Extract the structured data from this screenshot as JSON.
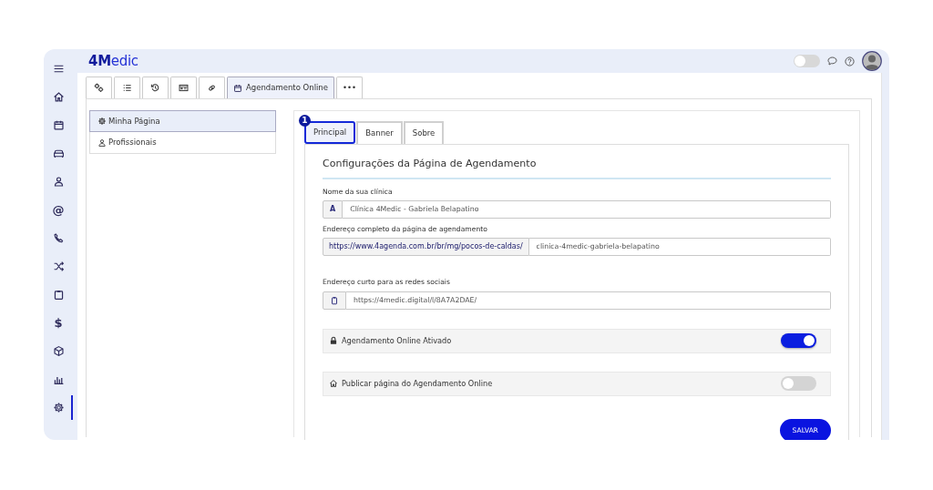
{
  "header": {
    "logo": "**4M**edic",
    "theme_toggle": {
      "on": false
    }
  },
  "sidebar": {
    "items": [
      {
        "kind": "home",
        "selected": false
      },
      {
        "kind": "calendar",
        "selected": false
      },
      {
        "kind": "sofa",
        "selected": false
      },
      {
        "kind": "person",
        "selected": false
      },
      {
        "kind": "glyph",
        "text": "@",
        "selected": false
      },
      {
        "kind": "phone",
        "selected": false
      },
      {
        "kind": "shuffle",
        "selected": false
      },
      {
        "kind": "clipboard",
        "selected": false
      },
      {
        "kind": "glyph",
        "text": "$",
        "selected": false
      },
      {
        "kind": "cube",
        "selected": false
      },
      {
        "kind": "chart",
        "selected": false
      },
      {
        "kind": "gear",
        "selected": true
      }
    ]
  },
  "tabs": [
    {
      "kind": "gears",
      "selected": false
    },
    {
      "kind": "list",
      "selected": false
    },
    {
      "kind": "history",
      "selected": false
    },
    {
      "kind": "idcard",
      "selected": false
    },
    {
      "kind": "link",
      "selected": false
    },
    {
      "kind": "calendar",
      "label": "Agendamento Online",
      "selected": true
    },
    {
      "kind": "text",
      "label": "•••",
      "selected": false
    }
  ],
  "menu": [
    {
      "kind": "gear",
      "label": "Minha Página",
      "selected": true
    },
    {
      "kind": "person",
      "label": "Profissionais",
      "selected": false
    }
  ],
  "subtabs": [
    {
      "label": "Principal",
      "selected": true,
      "step": "1"
    },
    {
      "label": "Banner",
      "selected": false
    },
    {
      "label": "Sobre",
      "selected": false
    }
  ],
  "form": {
    "title": "Configurações da Página de Agendamento",
    "fields": [
      {
        "kind": "icon",
        "label": "Nome da sua clínica",
        "addon": "A",
        "value": "Clínica 4Medic - Gabriela Belapatino"
      },
      {
        "kind": "prefix",
        "label": "Endereço completo da página de agendamento",
        "addon": "https://www.4agenda.com.br/br/mg/pocos-de-caldas/",
        "value": "clinica-4medic-gabriela-belapatino"
      },
      {
        "kind": "copy",
        "label": "Endereço curto para as redes sociais",
        "value": "https://4medic.digital/l/8A7A2DAE/"
      }
    ],
    "switches": [
      {
        "kind": "lock",
        "label": "Agendamento Online Ativado",
        "on": true
      },
      {
        "kind": "home",
        "label": "Publicar página do Agendamento Online",
        "on": false
      }
    ],
    "save": "SALVAR"
  }
}
